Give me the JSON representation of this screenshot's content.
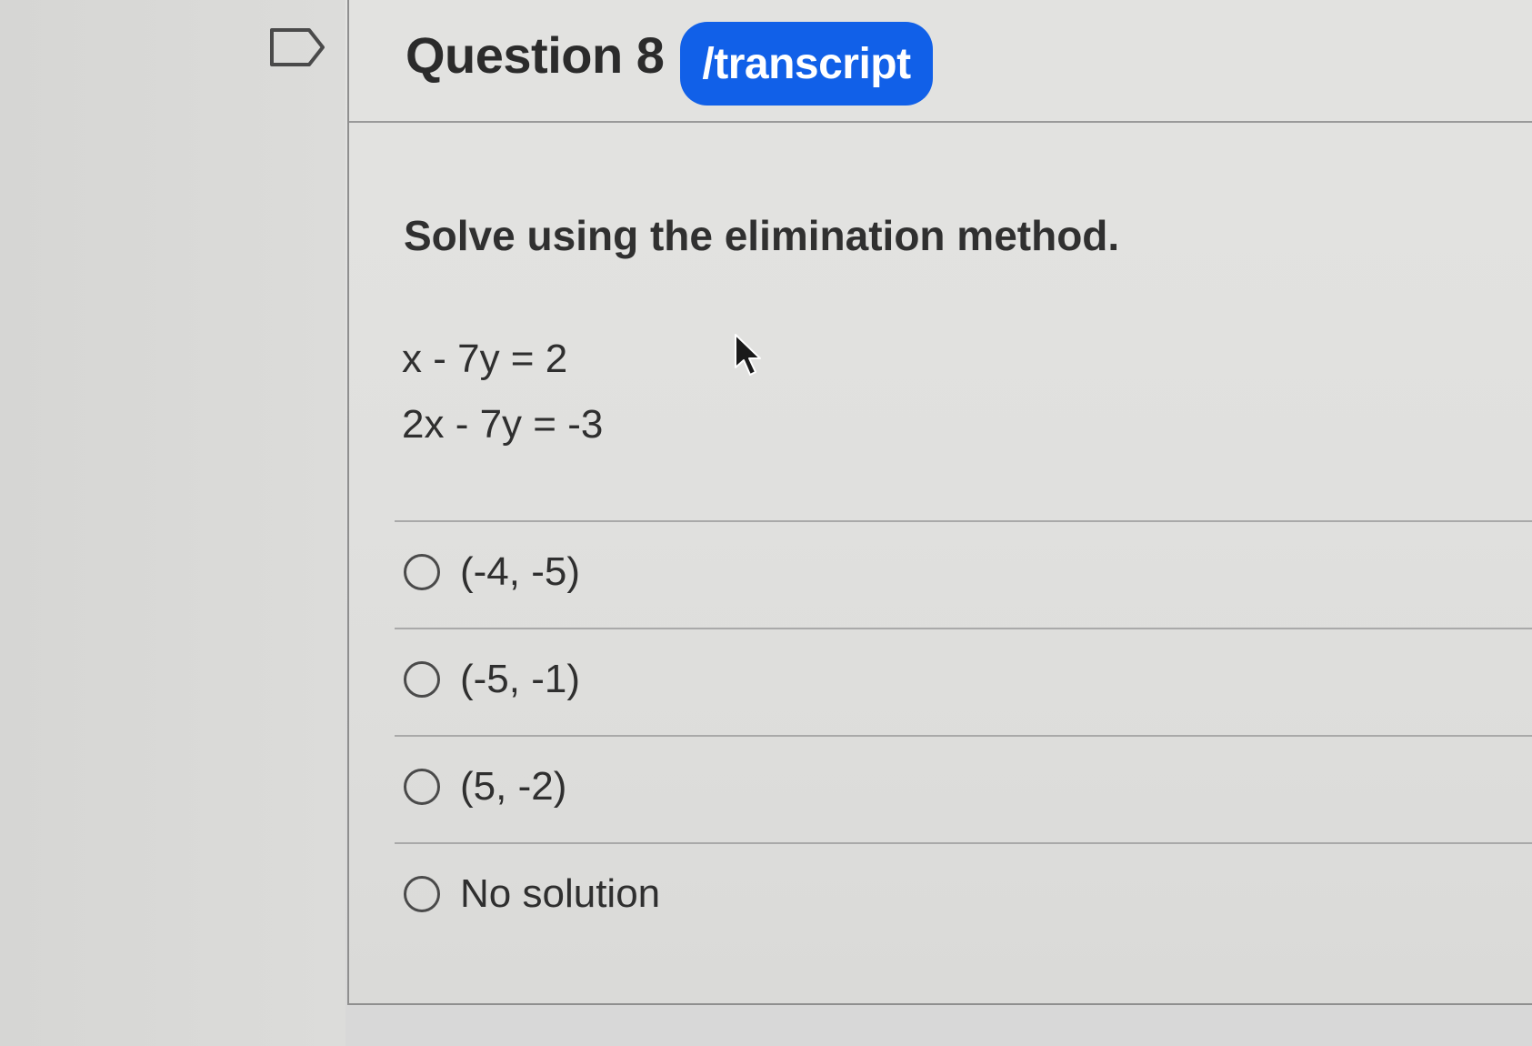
{
  "question": {
    "title": "Question 8",
    "badge": "/transcript",
    "prompt": "Solve using the elimination method.",
    "equations": [
      "x - 7y = 2",
      "2x - 7y = -3"
    ]
  },
  "answers": [
    {
      "label": "(-4, -5)"
    },
    {
      "label": "(-5, -1)"
    },
    {
      "label": "(5, -2)"
    },
    {
      "label": "No solution"
    }
  ],
  "icons": {
    "flag": "flag-icon",
    "cursor": "mouse-pointer-icon"
  },
  "colors": {
    "badge": "#1160e8",
    "text": "#2f2f2f"
  }
}
